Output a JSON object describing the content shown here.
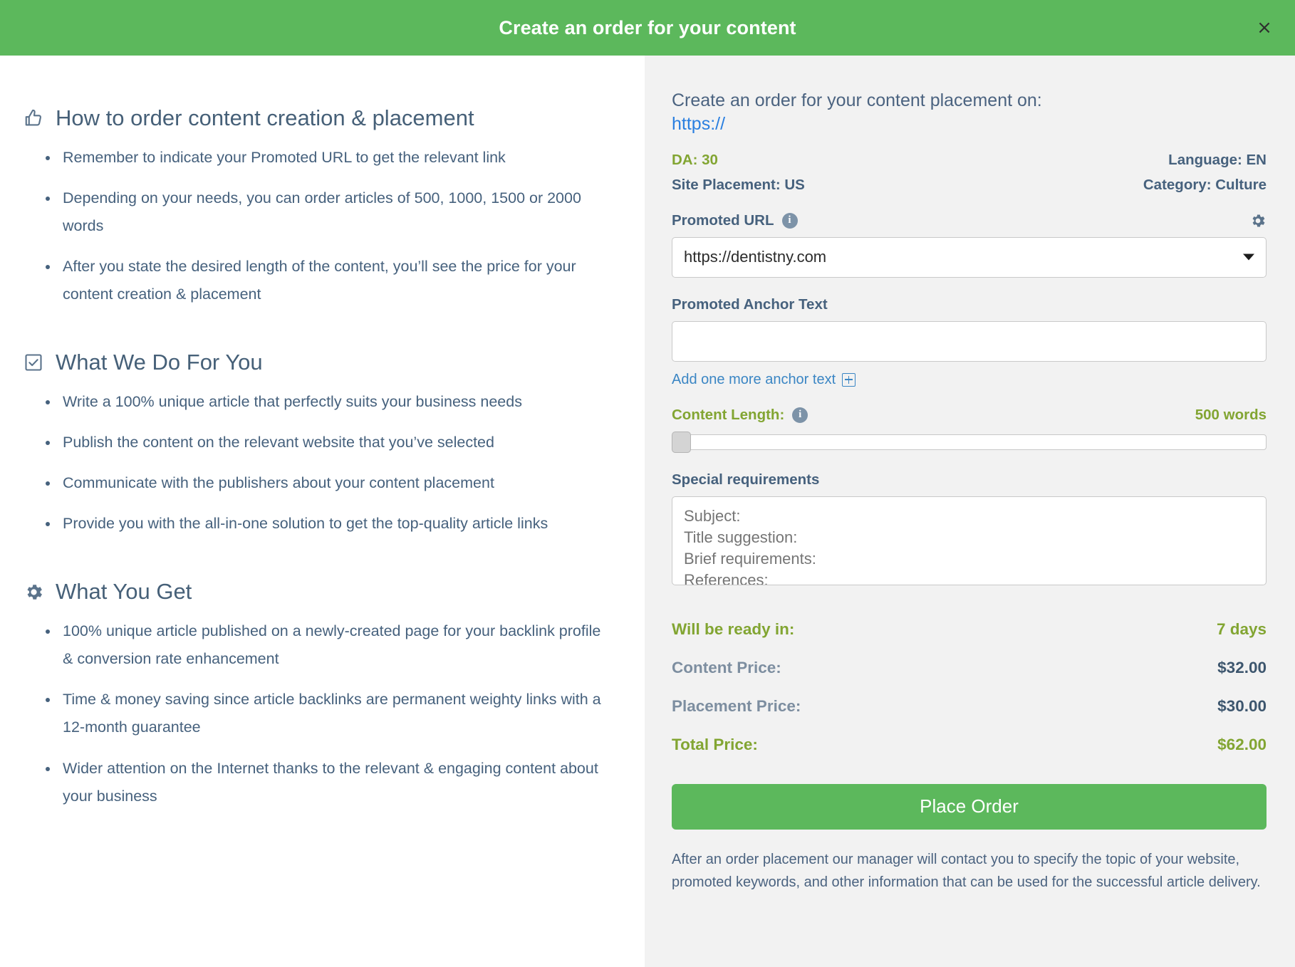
{
  "header": {
    "title": "Create an order for your content",
    "close_label": "×"
  },
  "left": {
    "sections": [
      {
        "icon": "thumbs-up-icon",
        "title": "How to order content creation & placement",
        "bullets": [
          "Remember to indicate your Promoted URL to get the relevant link",
          "Depending on your needs, you can order articles of 500, 1000, 1500 or 2000 words",
          "After you state the desired length of the content, you’ll see the price for your content creation & placement"
        ]
      },
      {
        "icon": "checkbox-checked-icon",
        "title": "What We Do For You",
        "bullets": [
          "Write a 100% unique article that perfectly suits your business needs",
          "Publish the content on the relevant website that you’ve selected",
          "Communicate with the publishers about your content placement",
          "Provide you with the all-in-one solution to get the top-quality article links"
        ]
      },
      {
        "icon": "gear-icon",
        "title": "What You Get",
        "bullets": [
          "100% unique article published on a newly-created page for your backlink profile & conversion rate enhancement",
          "Time & money saving since article backlinks are permanent weighty links with a 12-month guarantee",
          "Wider attention on the Internet thanks to the relevant & engaging content about your business"
        ]
      }
    ]
  },
  "right": {
    "title": "Create an order for your content placement on:",
    "site_url": "https://",
    "meta": {
      "da_label": "DA: 30",
      "language_label": "Language: EN",
      "site_placement_label": "Site Placement: US",
      "category_label": "Category: Culture"
    },
    "promoted_url": {
      "label": "Promoted URL",
      "value": "https://dentistny.com"
    },
    "anchor_text": {
      "label": "Promoted Anchor Text",
      "value": "",
      "placeholder": "",
      "add_more_label": "Add one more anchor text"
    },
    "content_length": {
      "label": "Content Length:",
      "value_label": "500 words"
    },
    "special_requirements": {
      "label": "Special requirements",
      "placeholder": "Subject:\nTitle suggestion:\nBrief requirements:\nReferences:"
    },
    "summary": [
      {
        "label": "Will be ready in:",
        "value": "7 days",
        "style": "green"
      },
      {
        "label": "Content Price:",
        "value": "$32.00",
        "style": "normal"
      },
      {
        "label": "Placement Price:",
        "value": "$30.00",
        "style": "normal"
      },
      {
        "label": "Total Price:",
        "value": "$62.00",
        "style": "green"
      }
    ],
    "place_order_label": "Place Order",
    "footnote": "After an order placement our manager will contact you to specify the topic of your website, promoted keywords, and other information that can be used for the successful article delivery."
  },
  "colors": {
    "brand_green": "#5cb85c",
    "accent_olive": "#82a532",
    "slate": "#46617d",
    "link_blue": "#2a7fe0"
  }
}
